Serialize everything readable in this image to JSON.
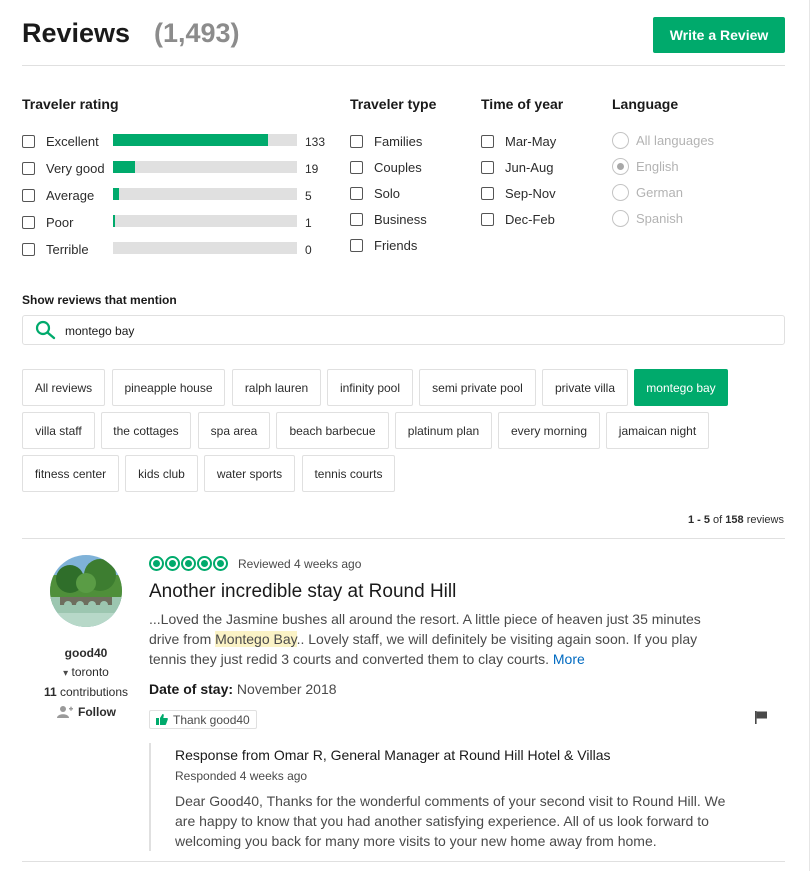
{
  "header": {
    "title": "Reviews",
    "count": "(1,493)",
    "write_review_label": "Write a Review"
  },
  "filters": {
    "traveler_rating": {
      "heading": "Traveler rating",
      "items": [
        {
          "label": "Excellent",
          "count": "133",
          "fill": 0.84
        },
        {
          "label": "Very good",
          "count": "19",
          "fill": 0.12
        },
        {
          "label": "Average",
          "count": "5",
          "fill": 0.03
        },
        {
          "label": "Poor",
          "count": "1",
          "fill": 0.01
        },
        {
          "label": "Terrible",
          "count": "0",
          "fill": 0
        }
      ]
    },
    "traveler_type": {
      "heading": "Traveler type",
      "items": [
        "Families",
        "Couples",
        "Solo",
        "Business",
        "Friends"
      ]
    },
    "time_of_year": {
      "heading": "Time of year",
      "items": [
        "Mar-May",
        "Jun-Aug",
        "Sep-Nov",
        "Dec-Feb"
      ]
    },
    "language": {
      "heading": "Language",
      "items": [
        "All languages",
        "English",
        "German",
        "Spanish"
      ],
      "selected": "English"
    }
  },
  "mention": {
    "heading": "Show reviews that mention",
    "search_value": "montego bay",
    "tags": [
      "All reviews",
      "pineapple house",
      "ralph lauren",
      "infinity pool",
      "semi private pool",
      "private villa",
      "montego bay",
      "villa staff",
      "the cottages",
      "spa area",
      "beach barbecue",
      "platinum plan",
      "every morning",
      "jamaican night",
      "fitness center",
      "kids club",
      "water sports",
      "tennis courts"
    ],
    "active_tag": "montego bay"
  },
  "pager": {
    "range": "1 - 5",
    "of": "of",
    "total": "158",
    "suffix": "reviews"
  },
  "review": {
    "user": {
      "name": "good40",
      "location": "toronto",
      "contributions_count": "11",
      "contributions_label": "contributions",
      "follow_label": "Follow"
    },
    "rating": 5,
    "reviewed": "Reviewed 4 weeks ago",
    "title": "Another incredible stay at Round Hill",
    "body_before": "...Loved the Jasmine bushes all around the resort. A little piece of heaven just 35 minutes drive from ",
    "body_highlight": "Montego Bay",
    "body_after": ".. Lovely staff, we will definitely be visiting again soon. If you play tennis they just redid 3 courts and converted them to clay courts. ",
    "more_label": "More",
    "date_of_stay_label": "Date of stay:",
    "date_of_stay": "November 2018",
    "thank_label": "Thank good40"
  },
  "response": {
    "from": "Response from Omar R, General Manager at Round Hill Hotel & Villas",
    "date": "Responded 4 weeks ago",
    "body": "Dear Good40, Thanks for the wonderful comments of your second visit to Round Hill. We are happy to know that you had another satisfying experience. All of us look forward to welcoming you back for many more visits to your new home away from home."
  },
  "colors": {
    "accent": "#00aa6c",
    "link": "#006ac1",
    "highlight": "#fbf3c6"
  }
}
